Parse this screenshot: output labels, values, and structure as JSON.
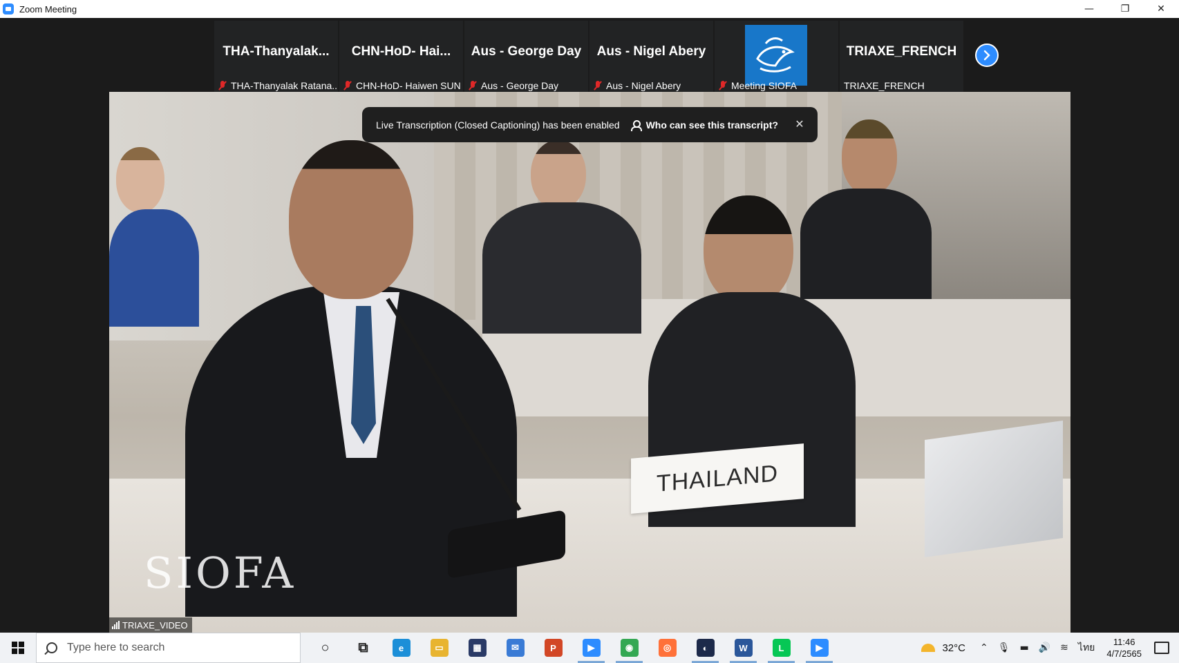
{
  "window": {
    "title": "Zoom Meeting",
    "controls": {
      "minimize": "—",
      "restore": "❐",
      "close": "✕"
    }
  },
  "participants": [
    {
      "display": "THA-Thanyalak...",
      "label": "THA-Thanyalak Ratana...",
      "muted": true
    },
    {
      "display": "CHN-HoD- Hai...",
      "label": "CHN-HoD- Haiwen SUN",
      "muted": true
    },
    {
      "display": "Aus - George Day",
      "label": "Aus - George Day",
      "muted": true
    },
    {
      "display": "Aus - Nigel Abery",
      "label": "Aus - Nigel Abery",
      "muted": true
    },
    {
      "display": "",
      "label": "Meeting SIOFA",
      "muted": true,
      "logo": "siofa-logo"
    },
    {
      "display": "TRIAXE_FRENCH",
      "label": "TRIAXE_FRENCH",
      "muted": false
    }
  ],
  "toast": {
    "message": "Live Transcription (Closed Captioning) has been enabled",
    "link": "Who can see this transcript?",
    "close": "✕"
  },
  "video": {
    "label": "TRIAXE_VIDEO",
    "nameplate": "THAILAND",
    "watermark": "SIOFA"
  },
  "taskbar": {
    "search_placeholder": "Type here to search",
    "apps": [
      {
        "name": "cortana-icon",
        "glyph": "○",
        "color": "transparent"
      },
      {
        "name": "task-view-icon",
        "glyph": "⧉",
        "color": "transparent"
      },
      {
        "name": "edge-icon",
        "glyph": "e",
        "color": "#1c8fd8"
      },
      {
        "name": "file-explorer-icon",
        "glyph": "▭",
        "color": "#e8b430"
      },
      {
        "name": "store-icon",
        "glyph": "▦",
        "color": "#2a3a66"
      },
      {
        "name": "mail-icon",
        "glyph": "✉",
        "color": "#3a7bd5"
      },
      {
        "name": "powerpoint-icon",
        "glyph": "P",
        "color": "#d24726"
      },
      {
        "name": "zoom-icon",
        "glyph": "▶",
        "color": "#2d8cff"
      },
      {
        "name": "chrome-icon",
        "glyph": "◉",
        "color": "#34a853"
      },
      {
        "name": "firefox-icon",
        "glyph": "◎",
        "color": "#ff7139"
      },
      {
        "name": "webex-icon",
        "glyph": "◐",
        "color": "#1d2a4a"
      },
      {
        "name": "word-icon",
        "glyph": "W",
        "color": "#2b579a"
      },
      {
        "name": "line-icon",
        "glyph": "L",
        "color": "#06c755"
      },
      {
        "name": "zoom-meeting-icon",
        "glyph": "▶",
        "color": "#2d8cff"
      }
    ],
    "tray": {
      "temperature": "32°C",
      "language": "ไทย",
      "time": "11:46",
      "date": "4/7/2565"
    }
  }
}
